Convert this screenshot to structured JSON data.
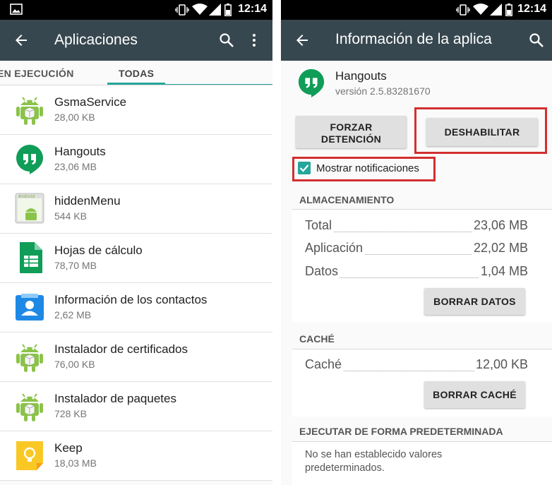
{
  "left": {
    "status": {
      "time": "12:14"
    },
    "appbar": {
      "title": "Aplicaciones"
    },
    "tabs": [
      {
        "label": "EN EJECUCIÓN"
      },
      {
        "label": "TODAS"
      }
    ],
    "apps": [
      {
        "name": "GsmaService",
        "size": "28,00 KB",
        "icon": "android-icon"
      },
      {
        "name": "Hangouts",
        "size": "23,06 MB",
        "icon": "hangouts-icon"
      },
      {
        "name": "hiddenMenu",
        "size": "544 KB",
        "icon": "android-box-icon"
      },
      {
        "name": "Hojas de cálculo",
        "size": "78,70 MB",
        "icon": "sheets-icon"
      },
      {
        "name": "Información de los contactos",
        "size": "2,62 MB",
        "icon": "contacts-icon"
      },
      {
        "name": "Instalador de certificados",
        "size": "76,00 KB",
        "icon": "android-icon"
      },
      {
        "name": "Instalador de paquetes",
        "size": "728 KB",
        "icon": "android-icon"
      },
      {
        "name": "Keep",
        "size": "18,03 MB",
        "icon": "keep-icon"
      }
    ]
  },
  "right": {
    "status": {
      "time": "12:14"
    },
    "appbar": {
      "title": "Información de la aplica"
    },
    "app": {
      "name": "Hangouts",
      "version": "versión 2.5.83281670"
    },
    "buttons": {
      "force_stop_line1": "FORZAR",
      "force_stop_line2": "DETENCIÓN",
      "disable": "DESHABILITAR"
    },
    "notifications_label": "Mostrar notificaciones",
    "storage": {
      "header": "ALMACENAMIENTO",
      "rows": [
        {
          "label": "Total",
          "value": "23,06 MB"
        },
        {
          "label": "Aplicación",
          "value": "22,02 MB"
        },
        {
          "label": "Datos",
          "value": "1,04 MB"
        }
      ],
      "clear_data": "BORRAR DATOS"
    },
    "cache": {
      "header": "CACHÉ",
      "rows": [
        {
          "label": "Caché",
          "value": "12,00 KB"
        }
      ],
      "clear_cache": "BORRAR CACHÉ"
    },
    "launch_default": {
      "header": "EJECUTAR DE FORMA PREDETERMINADA",
      "note": "No se han establecido valores predeterminados."
    }
  },
  "colors": {
    "appbar": "#37474f",
    "accent": "#26a69a",
    "highlight": "#d32f2f"
  }
}
